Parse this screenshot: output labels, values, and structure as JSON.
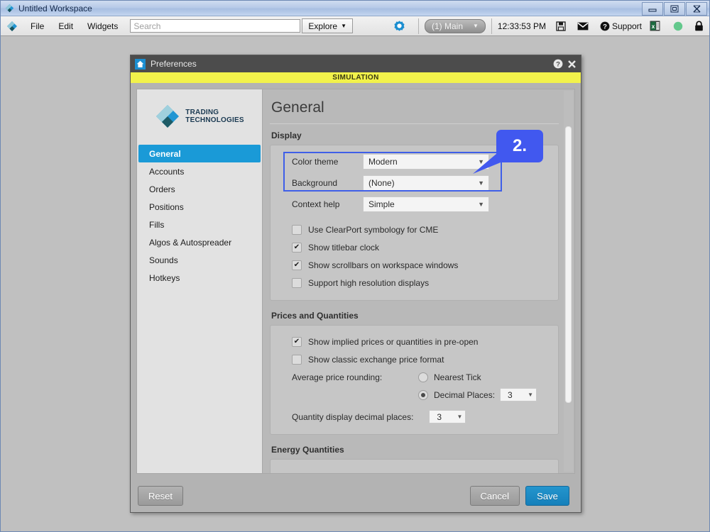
{
  "os_window": {
    "title": "Untitled Workspace",
    "app_icon": "tt-diamond-icon",
    "buttons": {
      "minimize": "minimize-icon",
      "maximize": "maximize-icon",
      "close": "close-icon"
    }
  },
  "toolbar": {
    "app_icon": "tt-diamond-icon",
    "menus": [
      "File",
      "Edit",
      "Widgets"
    ],
    "search": {
      "value": "",
      "placeholder": "Search"
    },
    "explore_label": "Explore",
    "settings_icon": "gear-icon",
    "workspace_selector": "(1) Main",
    "clock": "12:33:53 PM",
    "icons": [
      "save-icon",
      "mail-icon",
      "help-icon",
      "excel-icon",
      "status-green-icon",
      "lock-icon"
    ],
    "support_label": "Support"
  },
  "dialog": {
    "icon": "preferences-home-icon",
    "title": "Preferences",
    "help_icon": "help-circle-icon",
    "close_icon": "close-x-icon",
    "banner": "SIMULATION"
  },
  "sidebar": {
    "logo_line1": "TRADING",
    "logo_line2": "TECHNOLOGIES",
    "items": [
      {
        "label": "General",
        "active": true
      },
      {
        "label": "Accounts",
        "active": false
      },
      {
        "label": "Orders",
        "active": false
      },
      {
        "label": "Positions",
        "active": false
      },
      {
        "label": "Fills",
        "active": false
      },
      {
        "label": "Algos & Autospreader",
        "active": false
      },
      {
        "label": "Sounds",
        "active": false
      },
      {
        "label": "Hotkeys",
        "active": false
      }
    ]
  },
  "content": {
    "page_title": "General",
    "sections": {
      "display": {
        "label": "Display",
        "fields": [
          {
            "label": "Color theme",
            "value": "Modern"
          },
          {
            "label": "Background",
            "value": "(None)"
          },
          {
            "label": "Context help",
            "value": "Simple"
          }
        ],
        "checkboxes": [
          {
            "label": "Use ClearPort symbology for CME",
            "checked": false
          },
          {
            "label": "Show titlebar clock",
            "checked": true
          },
          {
            "label": "Show scrollbars on workspace windows",
            "checked": true
          },
          {
            "label": "Support high resolution displays",
            "checked": false
          }
        ]
      },
      "prices": {
        "label": "Prices and Quantities",
        "checkboxes": [
          {
            "label": "Show implied prices or quantities in pre-open",
            "checked": true
          },
          {
            "label": "Show classic exchange price format",
            "checked": false
          }
        ],
        "rounding_label": "Average price rounding:",
        "radio_nearest_tick": {
          "label": "Nearest Tick",
          "selected": false
        },
        "radio_decimal_places": {
          "label": "Decimal Places:",
          "selected": true,
          "value": "3"
        },
        "qty_decimal": {
          "label": "Quantity display decimal places:",
          "value": "3"
        }
      },
      "energy": {
        "label": "Energy Quantities"
      }
    }
  },
  "callout": {
    "number": "2.",
    "color": "#4158ef"
  },
  "footer": {
    "reset_label": "Reset",
    "cancel_label": "Cancel",
    "save_label": "Save"
  },
  "colors": {
    "accent_blue": "#1a9ad7",
    "banner_yellow": "#f2f24b",
    "callout_blue": "#4158ef",
    "titlebar_dark": "#4c4c4c"
  }
}
